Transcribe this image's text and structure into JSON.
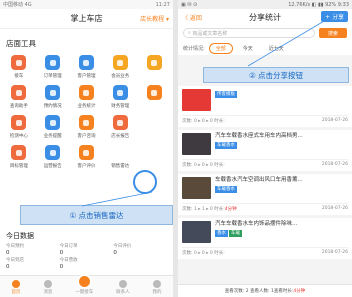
{
  "left": {
    "status_left": "中国移动 4G",
    "status_right": "11:27",
    "title": "掌上车店",
    "switch": "店长教程 ▾",
    "section": "店面工具",
    "tools": [
      {
        "label": "接车",
        "color": "#ef6b3e"
      },
      {
        "label": "订单管理",
        "color": "#3a8ee6"
      },
      {
        "label": "客户管理",
        "color": "#3a8ee6"
      },
      {
        "label": "会员业务",
        "color": "#f5a623"
      },
      {
        "label": "",
        "color": "#f5a623"
      },
      {
        "label": "查询助手",
        "color": "#ef6b3e"
      },
      {
        "label": "预约情况",
        "color": "#3a8ee6"
      },
      {
        "label": "业务统计",
        "color": "#f5821f"
      },
      {
        "label": "财务管理",
        "color": "#3a8ee6"
      },
      {
        "label": "",
        "color": "#f5821f"
      },
      {
        "label": "检测中心",
        "color": "#ef6b3e"
      },
      {
        "label": "业务提醒",
        "color": "#3a8ee6"
      },
      {
        "label": "客户咨询",
        "color": "#f5821f"
      },
      {
        "label": "店长报告",
        "color": "#ef6b3e"
      },
      {
        "label": "",
        "color": "#ffffff"
      },
      {
        "label": "目标管理",
        "color": "#ef6b3e"
      },
      {
        "label": "运营报告",
        "color": "#3a8ee6"
      },
      {
        "label": "客户评价",
        "color": "#f5821f"
      },
      {
        "label": "销售雷达",
        "color": "#ffffff"
      },
      {
        "label": "",
        "color": "#ffffff"
      }
    ],
    "callout": "① 点击销售雷达",
    "today_title": "今日数据",
    "stats": [
      {
        "label": "今日预约",
        "value": "0"
      },
      {
        "label": "今日订单",
        "value": "0"
      },
      {
        "label": "今日评价",
        "value": "0"
      },
      {
        "label": "今日到店",
        "value": "0"
      },
      {
        "label": "今日营收",
        "value": "0"
      },
      {
        "label": "",
        "value": ""
      }
    ],
    "tabs": [
      "首页",
      "消息",
      "一键接车",
      "联系人",
      "我的"
    ]
  },
  "right": {
    "status_left": "▣ ✉ ⊙",
    "status_right": "12.76K/s ◧ ▮▮ 92% 9:33",
    "back": "〈 返回",
    "title": "分享统计",
    "share_btn": "+ 分享",
    "search_placeholder": "商品或文章名称",
    "search_btn": "搜索",
    "filter_label": "统计情况:",
    "filters": [
      "全部",
      "今天",
      "近七天"
    ],
    "callout": "② 点击分享按钮",
    "cards": [
      {
        "text": "",
        "tag1": "传客模板",
        "tag2": "",
        "times": "次数: 0 ▸ 0 ▸ 0 时长:",
        "time_red": "",
        "date": "2018-07-26",
        "thumb": "#e53935"
      },
      {
        "text": "汽车车载香水座式车用车内高档男...",
        "tag1": "车载香水",
        "tag2": "",
        "times": "次数: 0 ▸ 0 ▸ 0 时长:",
        "time_red": "",
        "date": "2018-07-26",
        "thumb": "#3e3a40"
      },
      {
        "text": "车载香水汽车空调出风口车用香薰...",
        "tag1": "车载香水",
        "tag2": "",
        "times": "次数: 1 ▸ 1 ▸ 0 时长:",
        "time_red": "4分钟",
        "date": "2018-07-26",
        "thumb": "#5a4a3a"
      },
      {
        "text": "汽车车载香水车内饰品摆件除味...",
        "tag1": "香水",
        "tag2": "车载",
        "times": "次数: 0 ▸ 0 ▸ 0 时长:",
        "time_red": "",
        "date": "2018-07-26",
        "thumb": "#444a5a"
      }
    ],
    "footer_a": "查看次数: 2 查看人数: 1 ",
    "footer_b": "查看时长: ",
    "footer_c": "4分钟"
  }
}
